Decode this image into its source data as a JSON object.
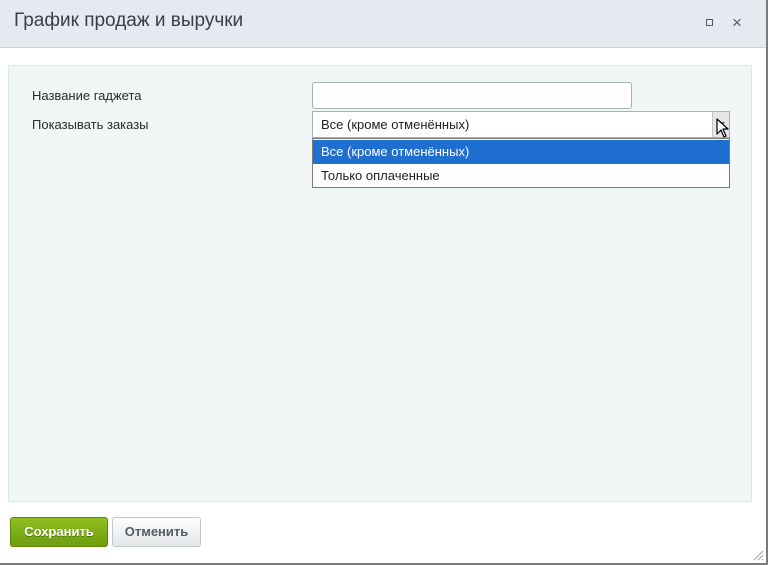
{
  "dialog": {
    "title": "График продаж и выручки",
    "maximize_icon": "maximize-icon",
    "close_icon": "close-icon",
    "close_glyph": "×"
  },
  "form": {
    "gadget_name": {
      "label": "Название гаджета",
      "value": ""
    },
    "show_orders": {
      "label": "Показывать заказы",
      "selected": "Все (кроме отменённых)",
      "options": [
        "Все (кроме отменённых)",
        "Только оплаченные"
      ],
      "expanded": true,
      "highlighted_index": 0
    }
  },
  "footer": {
    "save_label": "Сохранить",
    "cancel_label": "Отменить"
  },
  "colors": {
    "titlebar_bg": "#e4eaef",
    "content_bg": "#f1f6f6",
    "selected_option_bg": "#1f6fd1",
    "save_button": "#7aab14"
  }
}
